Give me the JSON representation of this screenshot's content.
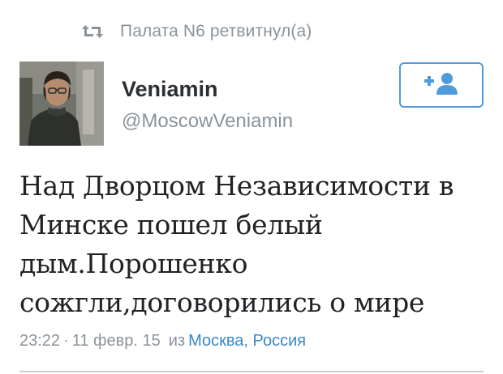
{
  "retweet": {
    "icon": "retweet-icon",
    "text": "Палата N6 ретвитнул(а)"
  },
  "user": {
    "name": "Veniamin",
    "handle": "@MoscowVeniamin",
    "avatar": "user-avatar-photo"
  },
  "follow_button": {
    "icon": "add-user-icon",
    "color": "#4f9bd9"
  },
  "tweet": {
    "text": "Над Дворцом Независимости в\nМинске пошел белый\nдым.Порошенко\nсожгли,договорились о мире"
  },
  "meta": {
    "time": "23:22",
    "separator": "·",
    "date": "11 февр. 15",
    "from_label": "из",
    "location": "Москва, Россия",
    "link_color": "#3b86c8"
  }
}
